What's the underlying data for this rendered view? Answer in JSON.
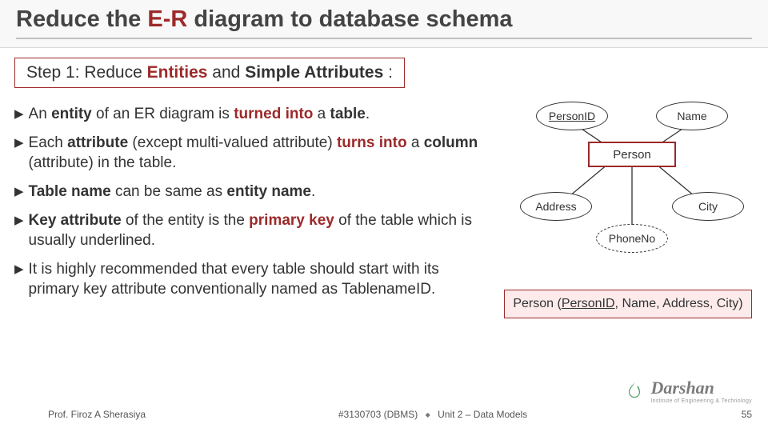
{
  "title": {
    "pre": "Reduce the ",
    "accent": "E-R",
    "post": " diagram to database schema"
  },
  "step": {
    "prefix": "Step 1: Reduce ",
    "word1": "Entities",
    "mid": " and ",
    "word2": "Simple Attributes",
    "suffix": " :"
  },
  "bullets": [
    {
      "html": "An <b>entity</b> of an ER diagram is <span class='red'>turned into</span> a <b>table</b>."
    },
    {
      "html": "Each <b>attribute</b> (except multi-valued attribute) <span class='red'>turns into</span> a <b>column</b> (attribute) in the table."
    },
    {
      "html": "<b>Table name</b> can be same as <b>entity name</b>."
    },
    {
      "html": "<b>Key attribute</b> of the entity is the <span class='red'>primary key</span> of the table which is usually underlined."
    },
    {
      "html": "It is highly recommended that every table should start with its primary key attribute conventionally named as TablenameID."
    }
  ],
  "er": {
    "entity": "Person",
    "attrs": {
      "person_id": "PersonID",
      "name": "Name",
      "address": "Address",
      "city": "City",
      "phone": "PhoneNo"
    }
  },
  "schema": {
    "table": "Person",
    "pk": "PersonID",
    "cols": [
      "Name",
      "Address",
      "City"
    ]
  },
  "footer": {
    "author": "Prof. Firoz A Sherasiya",
    "code": "#3130703 (DBMS)",
    "unit": "Unit 2 – Data Models",
    "page": "55"
  },
  "logo": {
    "name": "Darshan",
    "sub": "Institute of Engineering & Technology"
  }
}
